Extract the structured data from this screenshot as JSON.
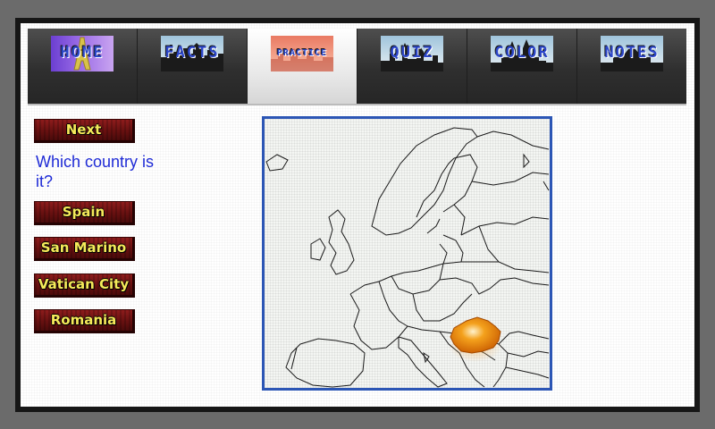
{
  "tabs": [
    {
      "label": "HOME",
      "icon": "eiffel-tower-icon",
      "selected": false
    },
    {
      "label": "FACTS",
      "icon": "city-skyline-icon",
      "selected": false
    },
    {
      "label": "PRACTICE",
      "icon": "city-skyline-icon",
      "selected": true
    },
    {
      "label": "QUIZ",
      "icon": "castle-icon",
      "selected": false
    },
    {
      "label": "COLOR",
      "icon": "church-icon",
      "selected": false
    },
    {
      "label": "NOTES",
      "icon": "house-icon",
      "selected": false
    }
  ],
  "practice": {
    "next_label": "Next",
    "question": "Which country is it?",
    "answers": [
      "Spain",
      "San Marino",
      "Vatican City",
      "Romania"
    ]
  },
  "map": {
    "icon": "europe-map",
    "highlighted_country": "Romania",
    "highlight_color": "#e07b00"
  },
  "colors": {
    "tab_label": "#2b46c8",
    "button_text": "#f6ea5a",
    "button_bg": "#6b1111",
    "question_text": "#1f2bd6",
    "map_border": "#2c56b5"
  }
}
